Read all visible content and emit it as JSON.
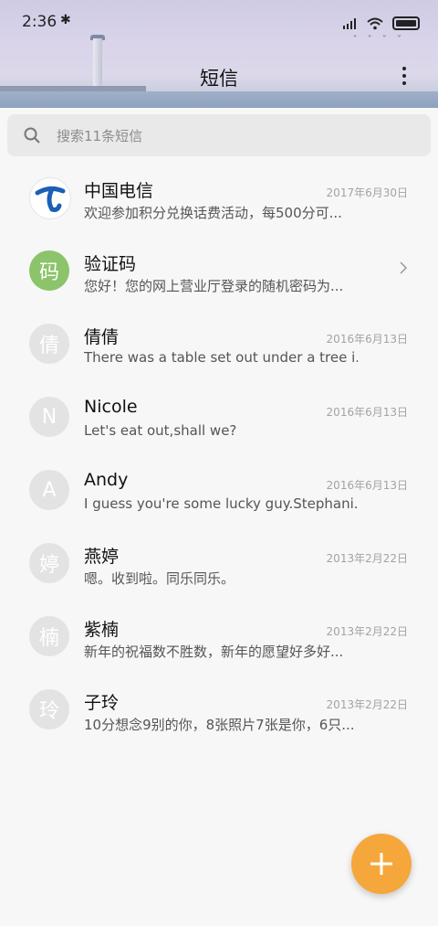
{
  "status": {
    "time": "2:36",
    "bluetooth_icon": "bluetooth-icon"
  },
  "header": {
    "title": "短信"
  },
  "search": {
    "placeholder": "搜索11条短信"
  },
  "threads": [
    {
      "avatar": "",
      "name": "中国电信",
      "preview": "欢迎参加积分兑换话费活动，每500分可...",
      "date": "2017年6月30日"
    },
    {
      "avatar": "码",
      "name": "验证码",
      "preview": "您好！您的网上营业厅登录的随机密码为...",
      "date": ""
    },
    {
      "avatar": "倩",
      "name": "倩倩",
      "preview": "There was a table set out under a tree i...",
      "date": "2016年6月13日"
    },
    {
      "avatar": "N",
      "name": "Nicole",
      "preview": "Let's eat out,shall we?",
      "date": "2016年6月13日"
    },
    {
      "avatar": "A",
      "name": "Andy",
      "preview": "I guess you're some lucky guy.Stephani...",
      "date": "2016年6月13日"
    },
    {
      "avatar": "婷",
      "name": "燕婷",
      "preview": "嗯。收到啦。同乐同乐。",
      "date": "2013年2月22日"
    },
    {
      "avatar": "楠",
      "name": "紫楠",
      "preview": "新年的祝福数不胜数，新年的愿望好多好...",
      "date": "2013年2月22日"
    },
    {
      "avatar": "玲",
      "name": "子玲",
      "preview": "10分想念9别的你，8张照片7张是你，6只...",
      "date": "2013年2月22日"
    }
  ],
  "colors": {
    "fab": "#f6a73b",
    "verify_avatar": "#8bc46a"
  }
}
